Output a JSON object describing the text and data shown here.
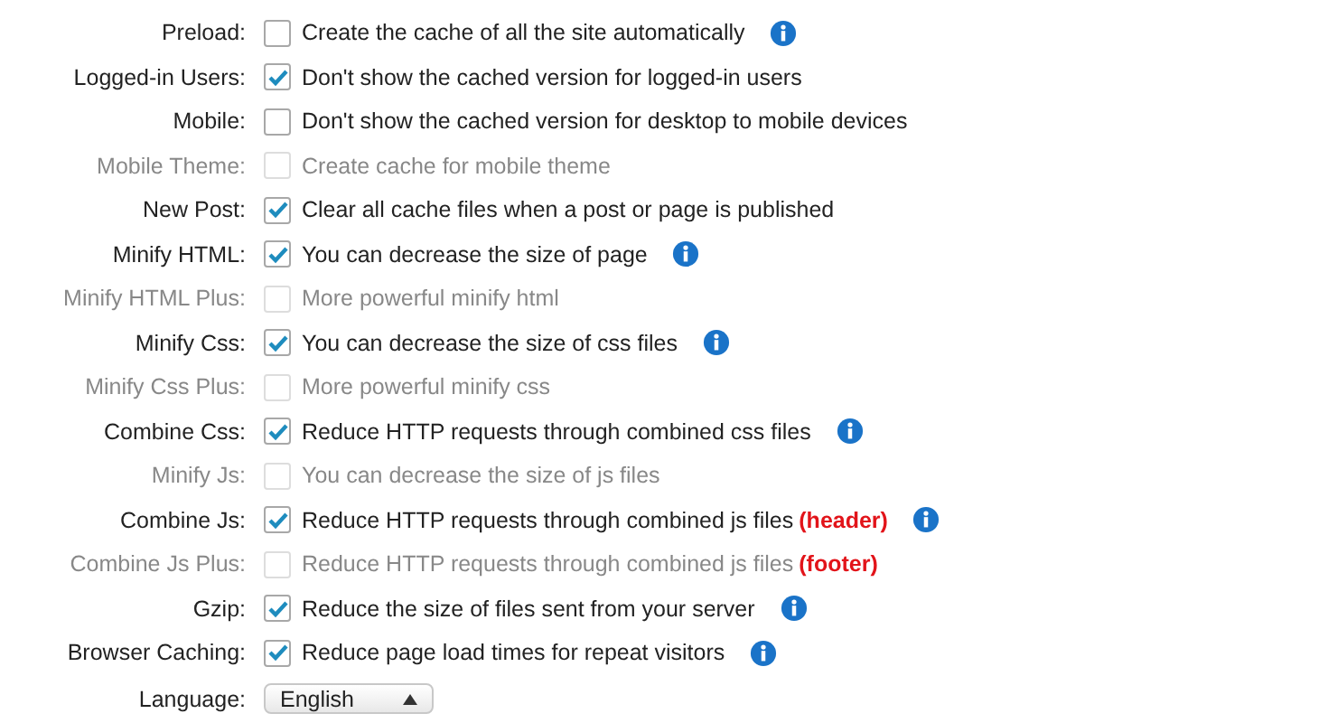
{
  "settings": [
    {
      "label": "Preload:",
      "text": "Create the cache of all the site automatically",
      "checked": false,
      "disabled": false,
      "info": true
    },
    {
      "label": "Logged-in Users:",
      "text": "Don't show the cached version for logged-in users",
      "checked": true,
      "disabled": false,
      "info": false
    },
    {
      "label": "Mobile:",
      "text": "Don't show the cached version for desktop to mobile devices",
      "checked": false,
      "disabled": false,
      "info": false
    },
    {
      "label": "Mobile Theme:",
      "text": "Create cache for mobile theme",
      "checked": false,
      "disabled": true,
      "info": false
    },
    {
      "label": "New Post:",
      "text": "Clear all cache files when a post or page is published",
      "checked": true,
      "disabled": false,
      "info": false
    },
    {
      "label": "Minify HTML:",
      "text": "You can decrease the size of page",
      "checked": true,
      "disabled": false,
      "info": true
    },
    {
      "label": "Minify HTML Plus:",
      "text": "More powerful minify html",
      "checked": false,
      "disabled": true,
      "info": false
    },
    {
      "label": "Minify Css:",
      "text": "You can decrease the size of css files",
      "checked": true,
      "disabled": false,
      "info": true
    },
    {
      "label": "Minify Css Plus:",
      "text": "More powerful minify css",
      "checked": false,
      "disabled": true,
      "info": false
    },
    {
      "label": "Combine Css:",
      "text": "Reduce HTTP requests through combined css files",
      "checked": true,
      "disabled": false,
      "info": true
    },
    {
      "label": "Minify Js:",
      "text": "You can decrease the size of js files",
      "checked": false,
      "disabled": true,
      "info": false
    },
    {
      "label": "Combine Js:",
      "text": "Reduce HTTP requests through combined js files",
      "note": "(header)",
      "checked": true,
      "disabled": false,
      "info": true
    },
    {
      "label": "Combine Js Plus:",
      "text": "Reduce HTTP requests through combined js files",
      "note": "(footer)",
      "checked": false,
      "disabled": true,
      "info": false
    },
    {
      "label": "Gzip:",
      "text": "Reduce the size of files sent from your server",
      "checked": true,
      "disabled": false,
      "info": true
    },
    {
      "label": "Browser Caching:",
      "text": "Reduce page load times for repeat visitors",
      "checked": true,
      "disabled": false,
      "info": true
    }
  ],
  "language": {
    "label": "Language:",
    "value": "English"
  }
}
